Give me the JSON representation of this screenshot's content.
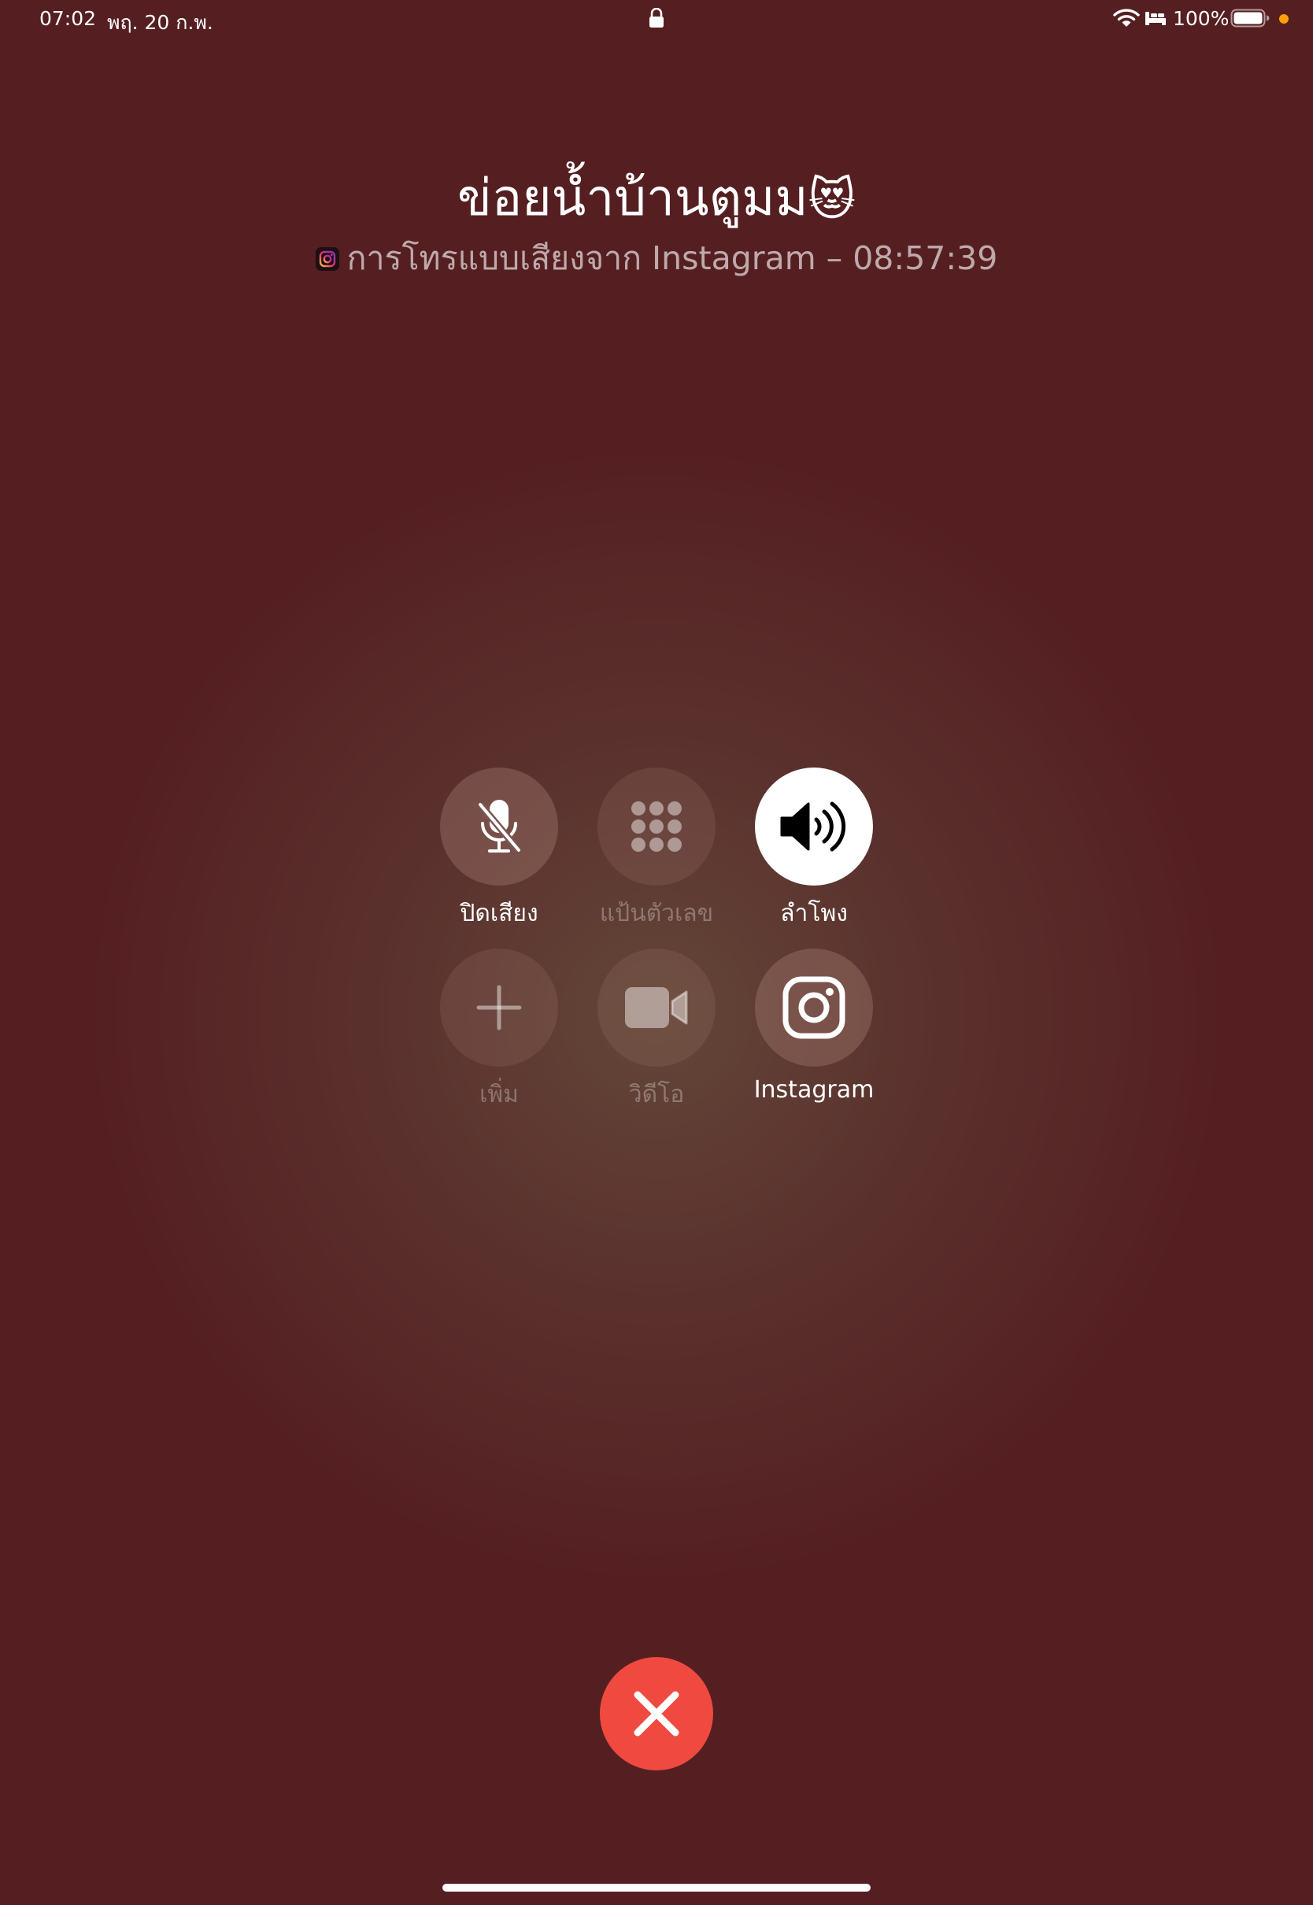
{
  "status_bar": {
    "time": "07:02",
    "date": "พฤ. 20 ก.พ.",
    "battery_percent": "100%",
    "battery_level": 1.0,
    "lock_icon": "lock-icon",
    "wifi_icon": "wifi-icon",
    "sleep_icon": "bed-icon",
    "privacy_dot_color": "#ff9f0a"
  },
  "call": {
    "caller_name": "ข่อยน้ำบ้านตูมม",
    "caller_emoji": "😻",
    "info_text": "การโทรแบบเสียงจาก Instagram  – 08:57:39",
    "app_icon": "instagram-icon"
  },
  "controls": [
    {
      "label": "ปิดเสียง",
      "icon": "mic-slash-icon",
      "state": "normal"
    },
    {
      "label": "แป้นตัวเลข",
      "icon": "keypad-icon",
      "state": "disabled"
    },
    {
      "label": "ลำโพง",
      "icon": "speaker-icon",
      "state": "active"
    },
    {
      "label": "เพิ่ม",
      "icon": "plus-icon",
      "state": "disabled"
    },
    {
      "label": "วิดีโอ",
      "icon": "video-icon",
      "state": "disabled"
    },
    {
      "label": "Instagram",
      "icon": "instagram-icon",
      "state": "normal"
    }
  ],
  "end_call": {
    "icon": "close-icon",
    "color": "#f04a40"
  },
  "colors": {
    "background": "#551f22",
    "end_call": "#f04a40",
    "active_button": "#ffffff"
  }
}
